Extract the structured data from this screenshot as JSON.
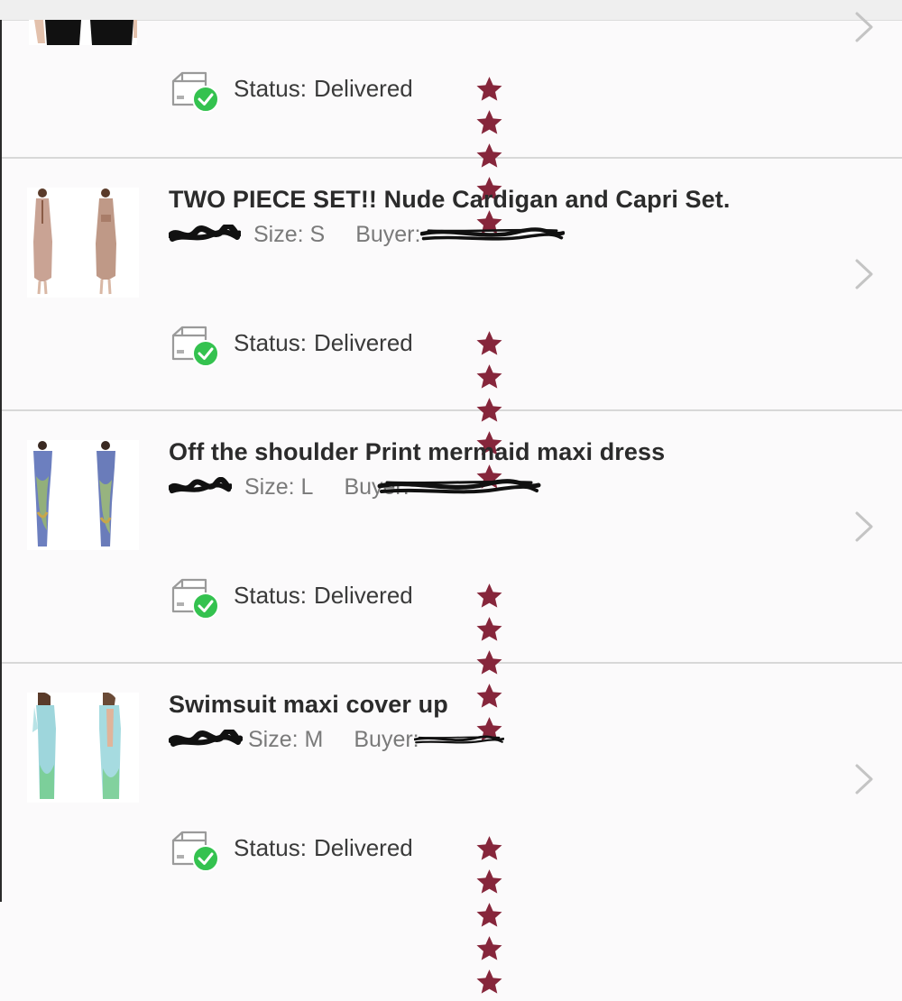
{
  "colors": {
    "star": "#86263b",
    "check": "#34c24f",
    "chevron": "#c4c4c4",
    "divider": "#d8d8d8"
  },
  "orders": [
    {
      "title": "",
      "size": "",
      "buyer": "",
      "status_label": "Status:",
      "status_value": "Delivered",
      "rating": 5
    },
    {
      "title": "TWO PIECE SET!! Nude Cardigan and Capri Set.",
      "size": "Size: S",
      "buyer": "Buyer:",
      "status_label": "Status:",
      "status_value": "Delivered",
      "rating": 5
    },
    {
      "title": "Off the shoulder Print mermaid maxi dress",
      "size": "Size: L",
      "buyer": "Buyer:",
      "status_label": "Status:",
      "status_value": "Delivered",
      "rating": 5
    },
    {
      "title": "Swimsuit maxi cover up",
      "size": "Size: M",
      "buyer": "Buyer:",
      "status_label": "Status:",
      "status_value": "Delivered",
      "rating": 5
    }
  ]
}
